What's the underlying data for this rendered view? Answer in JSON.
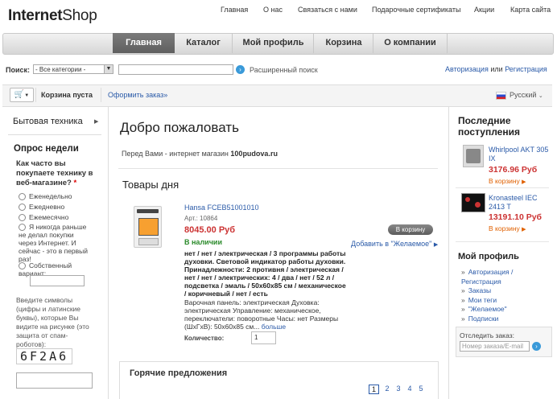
{
  "logo": {
    "bold": "Internet",
    "rest": "Shop"
  },
  "toplinks": [
    "Главная",
    "О нас",
    "Связаться с нами",
    "Подарочные сертификаты",
    "Акции",
    "Карта сайта"
  ],
  "nav": [
    "Главная",
    "Каталог",
    "Мой профиль",
    "Корзина",
    "О компании"
  ],
  "search": {
    "label": "Поиск:",
    "category": "- Все категории -",
    "value": "",
    "advanced": "Расширенный поиск"
  },
  "auth": {
    "login": "Авторизация",
    "or": "или",
    "register": "Регистрация"
  },
  "cartbar": {
    "empty": "Корзина пуста",
    "checkout": "Оформить заказ»",
    "language": "Русский"
  },
  "left": {
    "category": "Бытовая техника",
    "poll_title": "Опрос недели",
    "poll_question": "Как часто вы покупаете технику в веб-магазине?",
    "poll_required": "*",
    "options": [
      "Еженедельно",
      "Ежедневно",
      "Ежемесячно",
      "Я никогда раньше не делал покупки через Интернет. И сейчас - это в первый раз!",
      "Собственный вариант:"
    ],
    "captcha_info": "Введите символы (цифры и латинские буквы), которые Вы видите на рисунке (это защита от спам-роботов):",
    "captcha": "6F2A6"
  },
  "main": {
    "welcome": "Добро пожаловать",
    "intro_text": "Перед Вами - интернет магазин",
    "intro_site": "100pudova.ru",
    "deal_title": "Товары дня",
    "product": {
      "name": "Hansa FCEB51001010",
      "article": "Арт.: 10864",
      "price": "8045.00 Руб",
      "stock": "В наличии",
      "to_cart": "В корзину",
      "wish": "Добавить в \"Желаемое\"",
      "desc_bold": "нет / нет / электрическая / 3 программы работы духовки. Световой индикатор работы духовки. Принадлежности: 2 противня / электрическая / нет / нет / электрических: 4 / два / нет / 52 л / подсветка / эмаль / 50x60x85 см / механическое / коричневый / нет / есть",
      "desc_plain": "Варочная панель: электрическая Духовка: электрическая Управление: механическое, переключатели: поворотные Часы: нет Размеры (ШxГxВ): 50x60x85 см...",
      "more": "больше",
      "qty_label": "Количество:",
      "qty": "1"
    },
    "hot_title": "Горячие предложения",
    "pages": [
      "1",
      "2",
      "3",
      "4",
      "5"
    ]
  },
  "right": {
    "new_title": "Последние поступления",
    "items": [
      {
        "name": "Whirlpool AKT 305 IX",
        "price": "3176.96 Руб",
        "cart": "В корзину"
      },
      {
        "name": "Kronasteel IEC 2413 T",
        "price": "13191.10 Руб",
        "cart": "В корзину"
      }
    ],
    "profile_title": "Мой профиль",
    "profile_links": [
      "Авторизация / Регистрация",
      "Заказы",
      "Мои теги",
      "\"Желаемое\"",
      "Подписки"
    ],
    "track_label": "Отследить заказ:",
    "track_placeholder": "Номер заказа/E-mail"
  }
}
